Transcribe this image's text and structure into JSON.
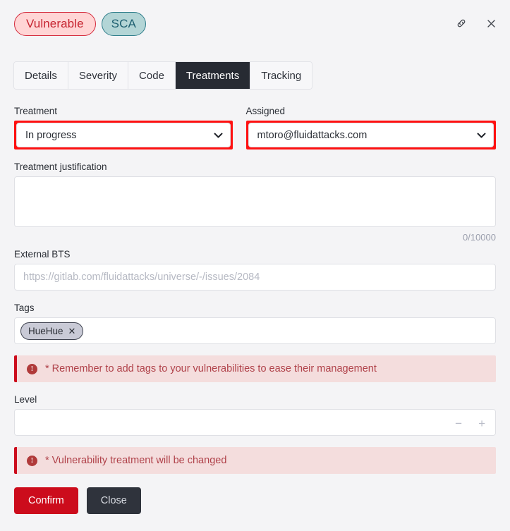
{
  "header": {
    "badges": [
      {
        "label": "Vulnerable",
        "name": "badge-vulnerable"
      },
      {
        "label": "SCA",
        "name": "badge-sca"
      }
    ],
    "link_icon": "link-icon",
    "close_icon": "close-icon"
  },
  "tabs": [
    {
      "label": "Details",
      "active": false
    },
    {
      "label": "Severity",
      "active": false
    },
    {
      "label": "Code",
      "active": false
    },
    {
      "label": "Treatments",
      "active": true
    },
    {
      "label": "Tracking",
      "active": false
    }
  ],
  "form": {
    "treatment": {
      "label": "Treatment",
      "value": "In progress",
      "options": [
        "In progress"
      ],
      "highlighted": true
    },
    "assigned": {
      "label": "Assigned",
      "value": "mtoro@fluidattacks.com",
      "options": [
        "mtoro@fluidattacks.com"
      ],
      "highlighted": true
    },
    "justification": {
      "label": "Treatment justification",
      "value": "",
      "placeholder": "",
      "counter": "0/10000"
    },
    "external_bts": {
      "label": "External BTS",
      "value": "",
      "placeholder": "https://gitlab.com/fluidattacks/universe/-/issues/2084"
    },
    "tags": {
      "label": "Tags",
      "items": [
        {
          "label": "HueHue",
          "remove_icon": "close-icon"
        }
      ]
    },
    "level": {
      "label": "Level",
      "value": "",
      "decrement_icon": "minus-icon",
      "increment_icon": "plus-icon"
    }
  },
  "alerts": [
    {
      "icon": "exclamation-circle-icon",
      "text": "* Remember to add tags to your vulnerabilities to ease their management"
    },
    {
      "icon": "exclamation-circle-icon",
      "text": "* Vulnerability treatment will be changed"
    }
  ],
  "actions": {
    "confirm_label": "Confirm",
    "close_label": "Close"
  },
  "colors": {
    "background": "#f4f4f6",
    "danger": "#cc0c1c",
    "highlight": "#ff1111",
    "tab_active": "#272b33",
    "alert_bg": "#f4dddd",
    "alert_text": "#b0424a",
    "badge_vulnerable_bg": "#ffd5d5",
    "badge_sca_bg": "#b3d5d6"
  }
}
